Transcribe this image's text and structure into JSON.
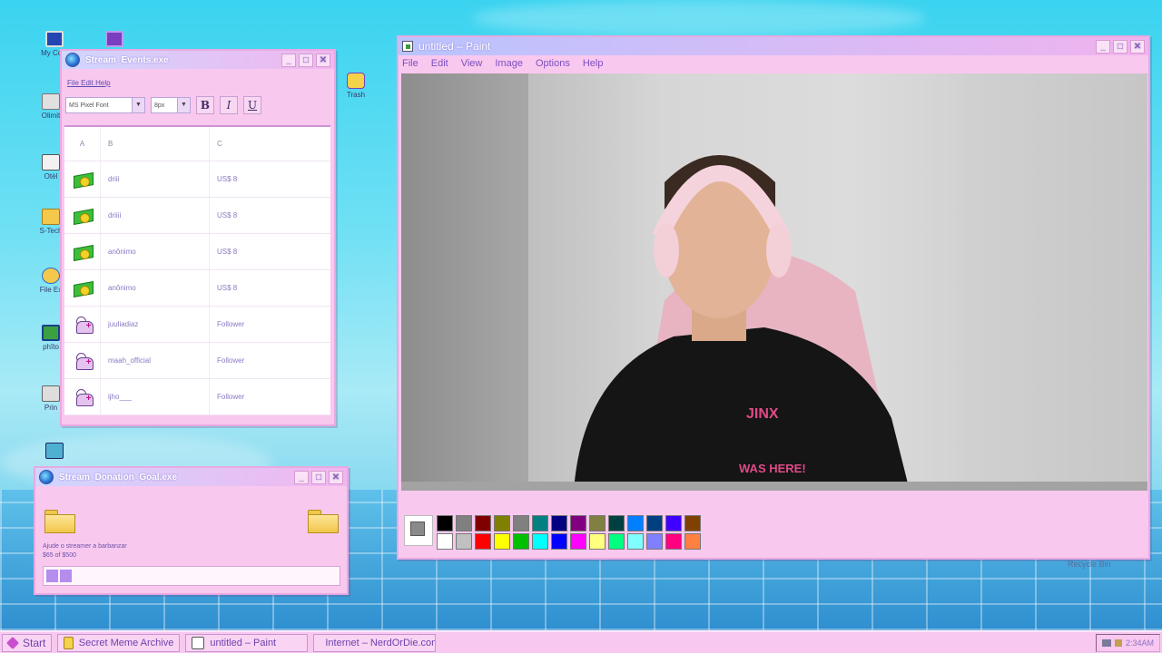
{
  "desktop": {
    "icons": [
      {
        "label": "My Com"
      },
      {
        "label": ""
      },
      {
        "label": "Olimit"
      },
      {
        "label": "Otèl"
      },
      {
        "label": "S-Tech"
      },
      {
        "label": "File Ex"
      },
      {
        "label": "phîto"
      },
      {
        "label": "Prin"
      },
      {
        "label": ""
      },
      {
        "label": "Trash"
      }
    ],
    "recycle_label": "Recycle Bin"
  },
  "events_window": {
    "title": "Stream_Events.exe",
    "menu": "File Edit Help",
    "font_select": "MS Pixel Font",
    "size_select": "8px",
    "bold": "B",
    "italic": "I",
    "underline": "U",
    "columns": [
      "A",
      "B",
      "C"
    ],
    "rows": [
      {
        "icon": "money-icon",
        "name": "driii",
        "value": "US$ 8"
      },
      {
        "icon": "money-icon",
        "name": "driiii",
        "value": "US$ 8"
      },
      {
        "icon": "money-icon",
        "name": "anônimo",
        "value": "US$ 8"
      },
      {
        "icon": "money-icon",
        "name": "anônimo",
        "value": "US$ 8"
      },
      {
        "icon": "follower-icon",
        "name": "juuliadiaz",
        "value": "Follower"
      },
      {
        "icon": "follower-icon",
        "name": "maah_official",
        "value": "Follower"
      },
      {
        "icon": "follower-icon",
        "name": "ijho___",
        "value": "Follower"
      }
    ]
  },
  "donation_window": {
    "title": "Stream_Donation_Goal.exe",
    "goal_text": "Ajude o streamer a barbanzar",
    "goal_amount": "$65 of $500",
    "progress": 0.13
  },
  "paint_window": {
    "title": "untitled – Paint",
    "menu": [
      "File",
      "Edit",
      "View",
      "Image",
      "Options",
      "Help"
    ],
    "palette": {
      "current": "#8a8a8a",
      "row1": [
        "#000000",
        "#808080",
        "#800000",
        "#808000",
        "#808080",
        "#008080",
        "#000080",
        "#800080",
        "#808040",
        "#004040",
        "#0080ff",
        "#004080",
        "#4000ff",
        "#804000"
      ],
      "row2": [
        "#ffffff",
        "#c0c0c0",
        "#ff0000",
        "#ffff00",
        "#00c000",
        "#00ffff",
        "#0000ff",
        "#ff00ff",
        "#ffff80",
        "#00ff80",
        "#80ffff",
        "#8080ff",
        "#ff0080",
        "#ff8040"
      ]
    }
  },
  "taskbar": {
    "start": "Start",
    "buttons": [
      "Secret Meme Archive",
      "untitled – Paint",
      "Internet – NerdOrDie.com"
    ],
    "clock": "2:34AM"
  },
  "colors": {
    "window_bg": "#f9c8ef",
    "accent": "#7a4fc0",
    "desktop": "#3ad3f0"
  }
}
